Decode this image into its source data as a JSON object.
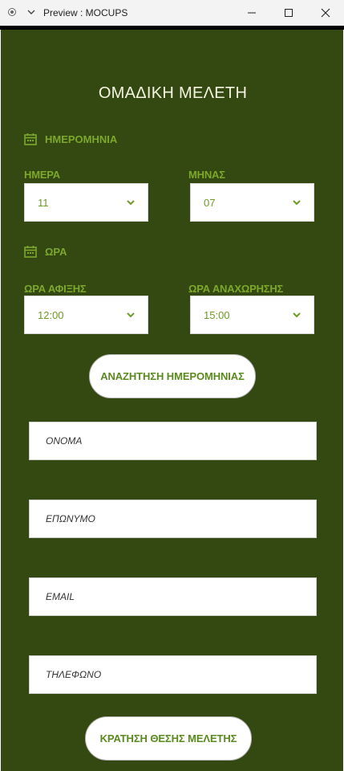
{
  "window": {
    "title": "Preview : MOCUPS"
  },
  "page": {
    "title": "ΟΜΑΔΙΚΗ ΜΕΛΕΤΗ"
  },
  "date_section": {
    "label": "ΗΜΕΡΟΜΗΝΙΑ",
    "day_label": "ΗΜΕΡΑ",
    "day_value": "11",
    "month_label": "ΜΗΝΑΣ",
    "month_value": "07"
  },
  "time_section": {
    "label": "ΩΡΑ",
    "arrival_label": "ΩΡΑ ΑΦΙΞΗΣ",
    "arrival_value": "12:00",
    "departure_label": "ΩΡΑ ΑΝΑΧΩΡΗΣΗΣ",
    "departure_value": "15:00"
  },
  "search_button": {
    "label": "ΑΝΑΖΗΤΗΣΗ ΗΜΕΡΟΜΗΝΙΑΣ"
  },
  "form": {
    "name_placeholder": "ΟΝΟΜΑ",
    "surname_placeholder": "ΕΠΩΝΥΜΟ",
    "email_placeholder": "EMAIL",
    "phone_placeholder": "ΤΗΛΕΦΩΝΟ"
  },
  "submit_button": {
    "label": "ΚΡΑΤΗΣΗ ΘΕΣΗΣ ΜΕΛΕΤΗΣ"
  },
  "colors": {
    "background": "#344911",
    "accent": "#7ca82d",
    "title": "#f4f4e0"
  }
}
